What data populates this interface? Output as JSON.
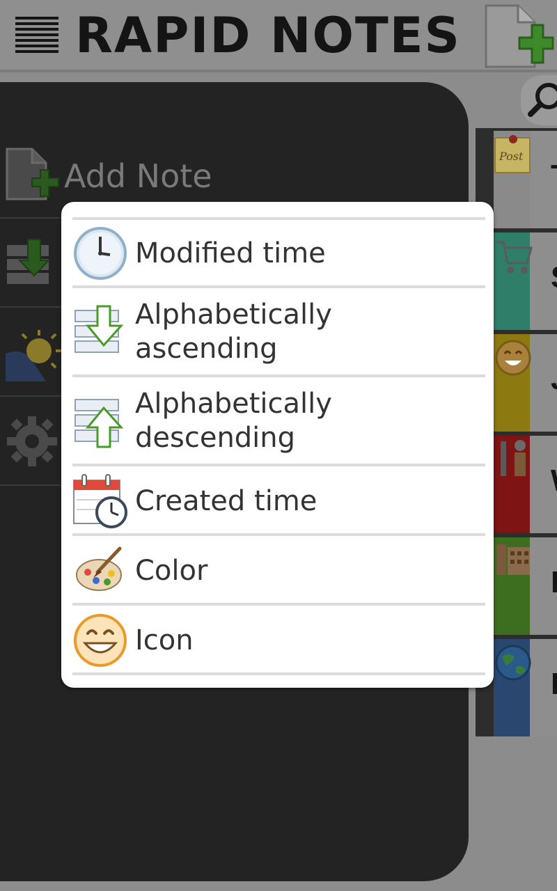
{
  "header": {
    "title": "RAPID NOTES",
    "menu_icon": "hamburger-menu-icon",
    "add_icon": "new-note-icon"
  },
  "drawer": {
    "add_note_label": "Add Note",
    "items": [
      {
        "icon": "new-note-icon"
      },
      {
        "icon": "sort-icon"
      },
      {
        "icon": "weather-theme-icon"
      },
      {
        "icon": "settings-gear-icon"
      }
    ]
  },
  "notes": [
    {
      "icon": "post-it-icon",
      "color": "#8a8a8a",
      "text": "T"
    },
    {
      "icon": "shopping-cart-icon",
      "color": "#2f7e6a",
      "text": "S"
    },
    {
      "icon": "smiley-icon",
      "color": "#8c7a10",
      "text": "J"
    },
    {
      "icon": "tools-icon",
      "color": "#7e1414",
      "text": "W"
    },
    {
      "icon": "phone-icon",
      "color": "#3d6e1f",
      "text": "P"
    },
    {
      "icon": "globe-icon",
      "color": "#2a4770",
      "text": "P"
    }
  ],
  "sort_dialog": {
    "options": [
      {
        "label": "Modified time",
        "icon": "clock-icon"
      },
      {
        "label": "Alphabetically ascending",
        "icon": "sort-ascending-icon"
      },
      {
        "label": "Alphabetically descending",
        "icon": "sort-descending-icon"
      },
      {
        "label": "Created time",
        "icon": "calendar-clock-icon"
      },
      {
        "label": "Color",
        "icon": "palette-icon"
      },
      {
        "label": "Icon",
        "icon": "smiley-icon"
      }
    ]
  }
}
